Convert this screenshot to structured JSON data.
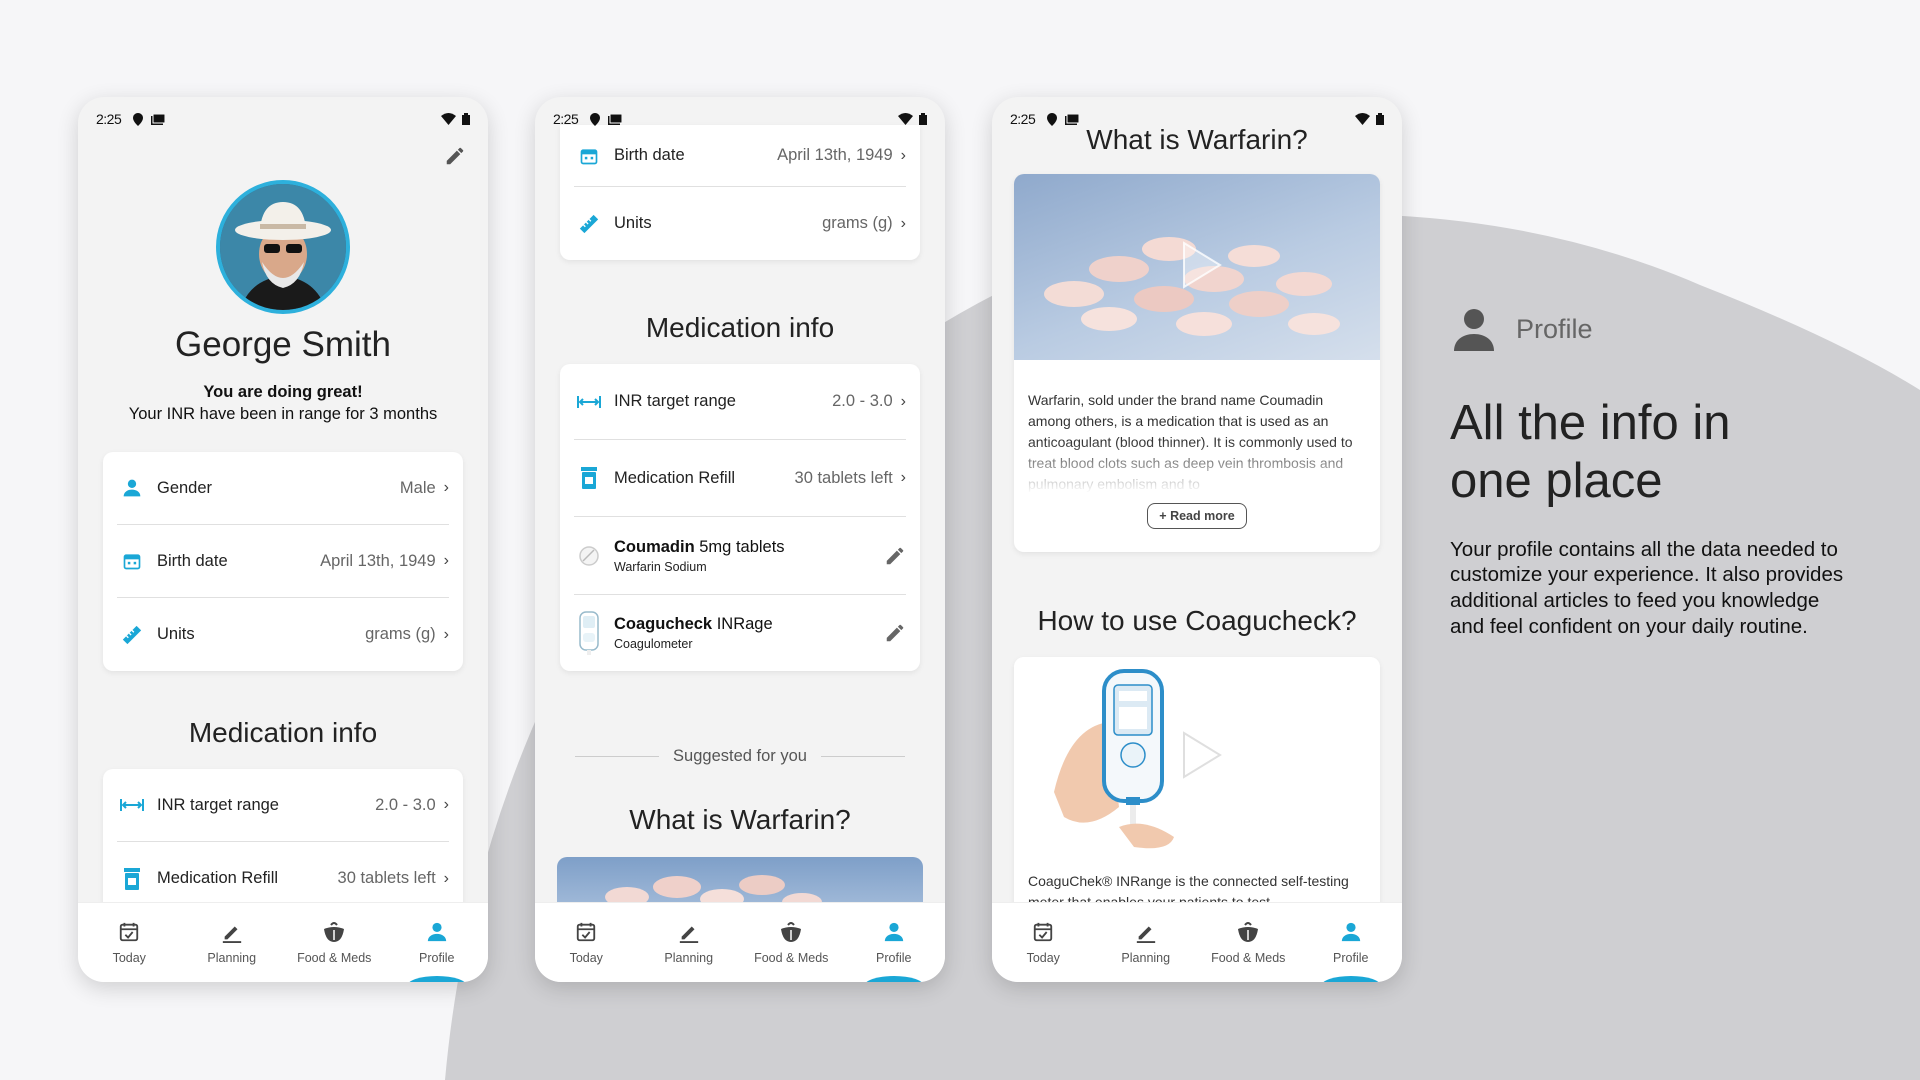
{
  "status": {
    "time": "2:25"
  },
  "tabs": [
    {
      "label": "Today",
      "icon": "calendar-check-icon"
    },
    {
      "label": "Planning",
      "icon": "pencil-icon"
    },
    {
      "label": "Food & Meds",
      "icon": "food-meds-icon"
    },
    {
      "label": "Profile",
      "icon": "person-icon"
    }
  ],
  "accent_color": "#1aa7d6",
  "profile": {
    "name": "George Smith",
    "status_bold": "You are doing great!",
    "status_text": "Your INR have been in range for 3 months",
    "rows": [
      {
        "label": "Gender",
        "value": "Male",
        "icon": "person-icon"
      },
      {
        "label": "Birth date",
        "value": "April 13th, 1949",
        "icon": "calendar-icon"
      },
      {
        "label": "Units",
        "value": "grams (g)",
        "icon": "ruler-icon"
      }
    ]
  },
  "medication": {
    "title": "Medication info",
    "rows": [
      {
        "label": "INR target range",
        "value": "2.0 - 3.0",
        "icon": "range-icon"
      },
      {
        "label": "Medication Refill",
        "value": "30 tablets left",
        "icon": "pill-bottle-icon"
      }
    ],
    "drugs": [
      {
        "name_bold": "Coumadin",
        "name_rest": " 5mg tablets",
        "sub": "Warfarin Sodium",
        "icon": "tablet-icon"
      },
      {
        "name_bold": "Coagucheck",
        "name_rest": " INRage",
        "sub": "Coagulometer",
        "icon": "meter-icon"
      }
    ]
  },
  "suggested": {
    "label": "Suggested for you"
  },
  "articles": [
    {
      "title": "What is Warfarin?",
      "text": "Warfarin, sold under the brand name Coumadin among others, is a medication that is used as an anticoagulant (blood thinner). It is commonly used to treat blood clots such as deep vein thrombosis and pulmonary embolism and to",
      "button": "+ Read more"
    },
    {
      "title": "How to use Coagucheck?",
      "text": "CoaguChek® INRange is the connected self-testing meter that enables your patients to test"
    }
  ],
  "panel": {
    "heading": "Profile",
    "title_line1": "All the info in",
    "title_line2": "one place",
    "text": "Your profile contains all the data needed to customize your experience. It also provides additional articles to feed you knowledge and feel confident on your daily routine."
  }
}
